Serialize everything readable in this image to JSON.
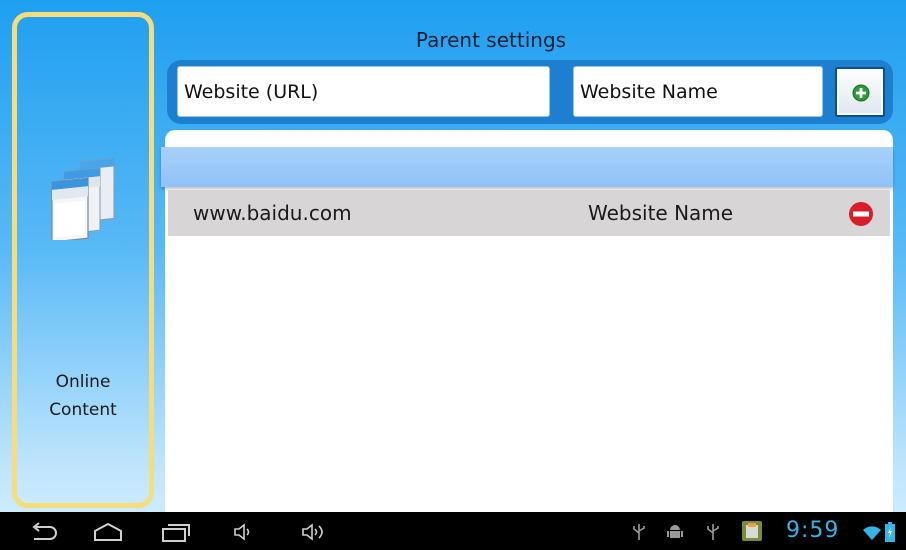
{
  "sidebar": {
    "label_line1": "Online",
    "label_line2": "Content",
    "icon": "browser-windows-icon",
    "border_color": "#f6dc7a"
  },
  "header": {
    "title": "Parent settings"
  },
  "form": {
    "url_placeholder": "Website (URL)",
    "name_placeholder": "Website Name",
    "add_icon": "add-icon"
  },
  "list": {
    "items": [
      {
        "url": "www.baidu.com",
        "name": "Website Name",
        "action_icon": "remove-icon"
      }
    ]
  },
  "navbar": {
    "buttons": [
      "back-icon",
      "home-icon",
      "recent-apps-icon",
      "volume-down-icon",
      "volume-up-icon"
    ],
    "status_icons": [
      "usb-icon",
      "android-debug-icon",
      "usb-icon",
      "app-notification-icon",
      "wifi-icon",
      "battery-icon"
    ],
    "time": "9:59"
  },
  "colors": {
    "accent": "#1d7fd0",
    "clock": "#33b5e5",
    "remove": "#d81e2a",
    "add": "#2e9b3a"
  }
}
